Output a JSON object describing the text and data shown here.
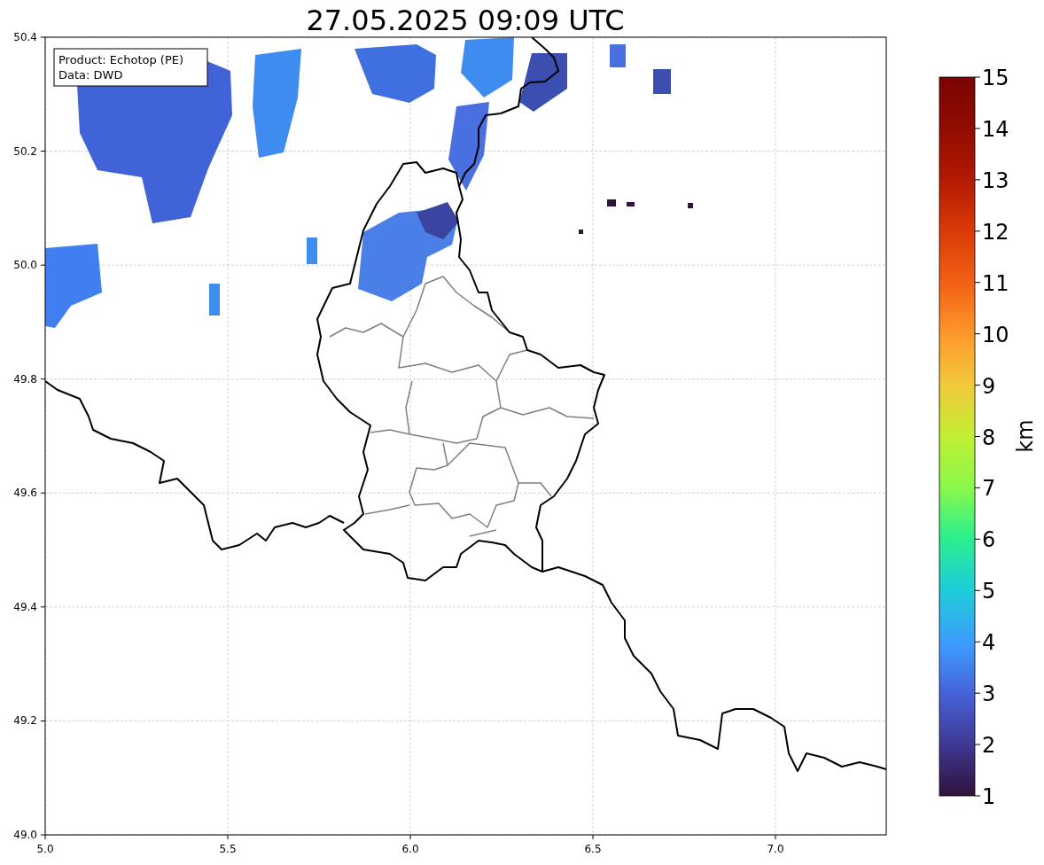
{
  "title": "27.05.2025 09:09 UTC",
  "legend_lines": [
    "Product: Echotop (PE)",
    "Data: DWD"
  ],
  "x_ticks": [
    "5.0",
    "5.5",
    "6.0",
    "6.5",
    "7.0"
  ],
  "y_ticks": [
    "50.4",
    "50.2",
    "50.0",
    "49.8",
    "49.6",
    "49.4",
    "49.2",
    "49.0"
  ],
  "colorbar": {
    "label": "km",
    "ticks": [
      "15",
      "14",
      "13",
      "12",
      "11",
      "10",
      "9",
      "8",
      "7",
      "6",
      "5",
      "4",
      "3",
      "2",
      "1"
    ]
  }
}
